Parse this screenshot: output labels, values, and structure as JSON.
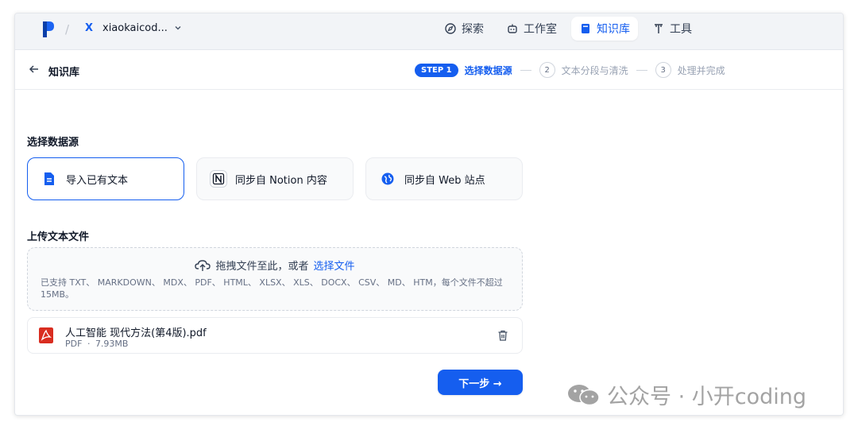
{
  "topbar": {
    "workspace_initial": "X",
    "workspace_name": "xiaokaicod...",
    "nav": [
      {
        "label": "探索",
        "icon": "compass-icon"
      },
      {
        "label": "工作室",
        "icon": "robot-icon"
      },
      {
        "label": "知识库",
        "icon": "book-icon",
        "active": true
      },
      {
        "label": "工具",
        "icon": "tool-icon"
      }
    ]
  },
  "subbar": {
    "back_label": "知识库",
    "steps": {
      "step1_pill": "STEP 1",
      "step1_label": "选择数据源",
      "step2_num": "2",
      "step2_label": "文本分段与清洗",
      "step3_num": "3",
      "step3_label": "处理并完成"
    }
  },
  "datasource": {
    "title": "选择数据源",
    "options": [
      {
        "label": "导入已有文本",
        "icon": "document-icon",
        "selected": true
      },
      {
        "label": "同步自 Notion 内容",
        "icon": "notion-icon"
      },
      {
        "label": "同步自 Web 站点",
        "icon": "globe-icon"
      }
    ]
  },
  "upload": {
    "title": "上传文本文件",
    "prompt": "拖拽文件至此，或者",
    "link": "选择文件",
    "note": "已支持 TXT、 MARKDOWN、 MDX、 PDF、 HTML、 XLSX、 XLS、 DOCX、 CSV、 MD、 HTM，每个文件不超过 15MB。"
  },
  "file": {
    "name": "人工智能 现代方法(第4版).pdf",
    "type": "PDF",
    "sep": "·",
    "size": "7.93MB"
  },
  "next_button": "下一步 →",
  "watermark": "公众号 · 小开coding",
  "colors": {
    "accent": "#155eef",
    "pdf": "#d92d20"
  }
}
